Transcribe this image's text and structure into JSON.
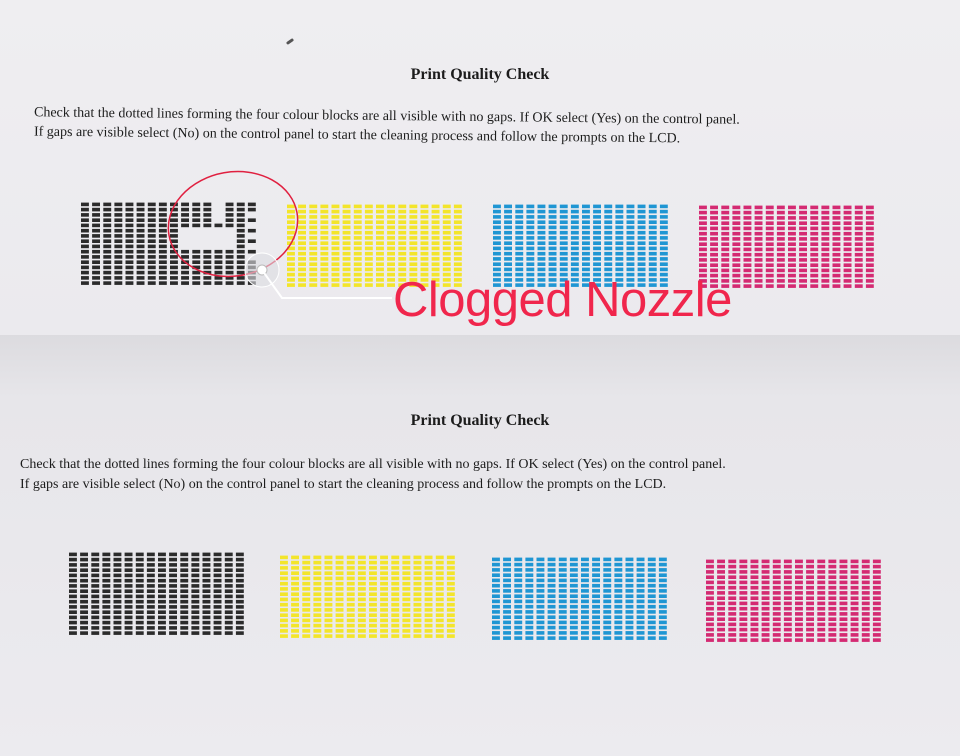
{
  "sheets": [
    {
      "title": "Print Quality Check",
      "instructions_line1": "Check that the dotted lines forming the four colour blocks are all visible with no gaps. If OK select (Yes) on the control panel.",
      "instructions_line2": "If gaps are visible select (No) on the control panel to start the cleaning process and follow the prompts on the LCD.",
      "blocks": [
        {
          "color": "black",
          "hex": "#2b2b2b",
          "clogged": true
        },
        {
          "color": "yellow",
          "hex": "#f3e52a",
          "clogged": false
        },
        {
          "color": "cyan",
          "hex": "#1f96d3",
          "clogged": false
        },
        {
          "color": "magenta",
          "hex": "#d42a72",
          "clogged": false
        }
      ]
    },
    {
      "title": "Print Quality Check",
      "instructions_line1": "Check that the dotted lines forming the four colour blocks are all visible with no gaps. If OK select (Yes) on the control panel.",
      "instructions_line2": "If gaps are visible select (No) on the control panel to start the cleaning process and follow the prompts on the LCD.",
      "blocks": [
        {
          "color": "black",
          "hex": "#2b2b2b",
          "clogged": false
        },
        {
          "color": "yellow",
          "hex": "#f3e52a",
          "clogged": false
        },
        {
          "color": "cyan",
          "hex": "#1f96d3",
          "clogged": false
        },
        {
          "color": "magenta",
          "hex": "#d42a72",
          "clogged": false
        }
      ]
    }
  ],
  "annotation": {
    "label": "Clogged Nozzle",
    "circle_color": "#e02040",
    "label_color": "#f0264c"
  }
}
